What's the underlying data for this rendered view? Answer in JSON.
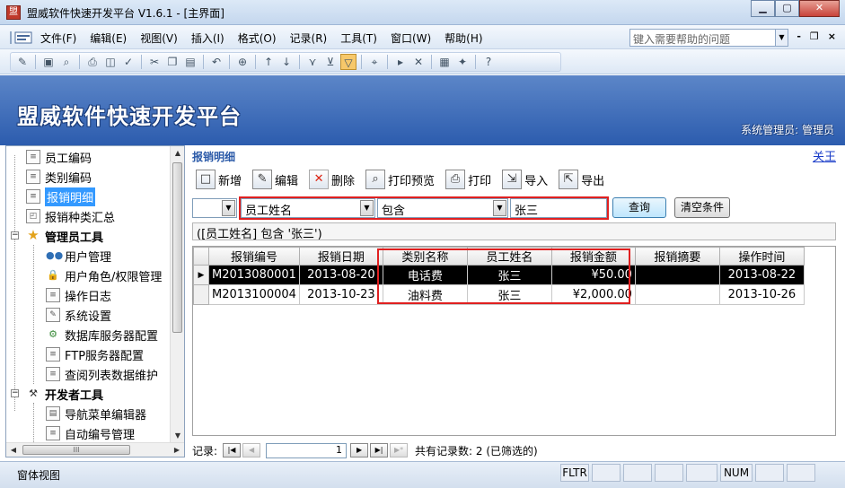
{
  "window": {
    "title": "盟威软件快速开发平台 V1.6.1 - [主界面]",
    "minimize": "▁",
    "restore": "▢",
    "close": "✕"
  },
  "menu": {
    "items": [
      "文件(F)",
      "编辑(E)",
      "视图(V)",
      "插入(I)",
      "格式(O)",
      "记录(R)",
      "工具(T)",
      "窗口(W)",
      "帮助(H)"
    ],
    "help_placeholder": "键入需要帮助的问题",
    "mdi_min": "-",
    "mdi_restore": "❐",
    "mdi_close": "×"
  },
  "toolbar": {
    "icons": [
      "design-view-icon",
      "save-icon",
      "file-search-icon",
      "print-icon",
      "print-preview-icon",
      "spelling-icon",
      "cut-icon",
      "copy-icon",
      "paste-icon",
      "undo-icon",
      "hyperlink-icon",
      "sort-ascending-icon",
      "sort-descending-icon",
      "filter-by-selection-icon",
      "filter-by-form-icon",
      "toggle-filter-icon",
      "find-icon",
      "new-record-icon",
      "delete-record-icon",
      "database-window-icon",
      "new-object-icon",
      "help-icon"
    ]
  },
  "banner": {
    "brand": "盟威软件快速开发平台",
    "user": "系统管理员: 管理员"
  },
  "nav": {
    "items": [
      {
        "label": "员工编码",
        "icon": "document-icon"
      },
      {
        "label": "类别编码",
        "icon": "document-icon"
      },
      {
        "label": "报销明细",
        "icon": "document-icon",
        "selected": true
      },
      {
        "label": "报销种类汇总",
        "icon": "report-icon"
      },
      {
        "label": "管理员工具",
        "icon": "star-icon",
        "group": true
      },
      {
        "label": "用户管理",
        "icon": "users-icon"
      },
      {
        "label": "用户角色/权限管理",
        "icon": "lock-icon"
      },
      {
        "label": "操作日志",
        "icon": "document-icon"
      },
      {
        "label": "系统设置",
        "icon": "settings-icon"
      },
      {
        "label": "数据库服务器配置",
        "icon": "gear-icon"
      },
      {
        "label": "FTP服务器配置",
        "icon": "document-icon"
      },
      {
        "label": "查阅列表数据维护",
        "icon": "document-icon"
      },
      {
        "label": "开发者工具",
        "icon": "tools-icon",
        "group": true
      },
      {
        "label": "导航菜单编辑器",
        "icon": "form-icon"
      },
      {
        "label": "自动编号管理",
        "icon": "document-icon"
      }
    ],
    "hscroll_grip": "III"
  },
  "form": {
    "title": "报销明细",
    "close_label": "关王",
    "actions": [
      {
        "label": "新增",
        "icon": "new-icon"
      },
      {
        "label": "编辑",
        "icon": "edit-icon"
      },
      {
        "label": "删除",
        "icon": "delete-icon"
      },
      {
        "label": "打印预览",
        "icon": "print-preview-icon"
      },
      {
        "label": "打印",
        "icon": "print-icon"
      },
      {
        "label": "导入",
        "icon": "import-icon"
      },
      {
        "label": "导出",
        "icon": "export-icon"
      }
    ],
    "filter": {
      "logic": "",
      "field": "员工姓名",
      "operator": "包含",
      "value": "张三",
      "query_button": "查询",
      "clear_button": "清空条件"
    },
    "condition_text": "([员工姓名] 包含 '张三')",
    "grid": {
      "columns": [
        "报销编号",
        "报销日期",
        "类别名称",
        "员工姓名",
        "报销金额",
        "报销摘要",
        "操作时间"
      ],
      "rows": [
        [
          "M2013080001",
          "2013-08-20",
          "电话费",
          "张三",
          "¥50.00",
          "",
          "2013-08-22"
        ],
        [
          "M2013100004",
          "2013-10-23",
          "油料费",
          "张三",
          "¥2,000.00",
          "",
          "2013-10-26"
        ]
      ]
    },
    "record_nav": {
      "label": "记录:",
      "current": "1",
      "summary": "共有记录数: 2  (已筛选的)"
    }
  },
  "statusbar": {
    "view": "窗体视图",
    "filter": "FLTR",
    "num": "NUM"
  },
  "colors": {
    "banner": "#2c5cae",
    "highlight": "#e02020",
    "selected": "#3399ff"
  }
}
